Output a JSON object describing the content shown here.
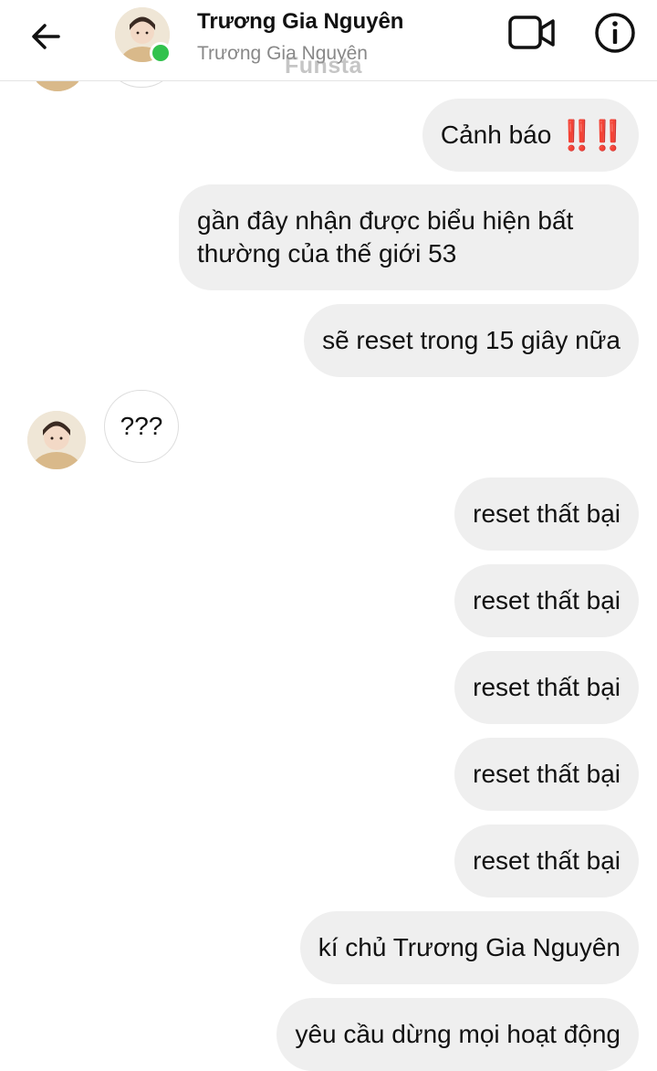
{
  "header": {
    "title": "Trương Gia Nguyên",
    "subtitle": "Trương Gia Nguyên",
    "watermark": "Funsta",
    "back_icon": "arrow-left-icon",
    "video_icon": "video-camera-icon",
    "info_icon": "info-icon",
    "online_color": "#31c24d"
  },
  "messages": {
    "m1_text": "Cảnh báo",
    "m1_emoji": "‼️‼️",
    "m2": "gần đây nhận được biểu hiện bất thường của thế giới 53",
    "m3": "sẽ reset trong 15 giây nữa",
    "m4": "???",
    "m5": "reset thất bại",
    "m6": "reset thất bại",
    "m7": "reset thất bại",
    "m8": "reset thất bại",
    "m9": "reset thất bại",
    "m10": "kí chủ Trương Gia Nguyên",
    "m11": "yêu cầu dừng mọi hoạt động"
  },
  "colors": {
    "outgoing_bubble": "#efefef",
    "incoming_bubble": "#ffffff",
    "alert_mark": "#e0202a"
  }
}
